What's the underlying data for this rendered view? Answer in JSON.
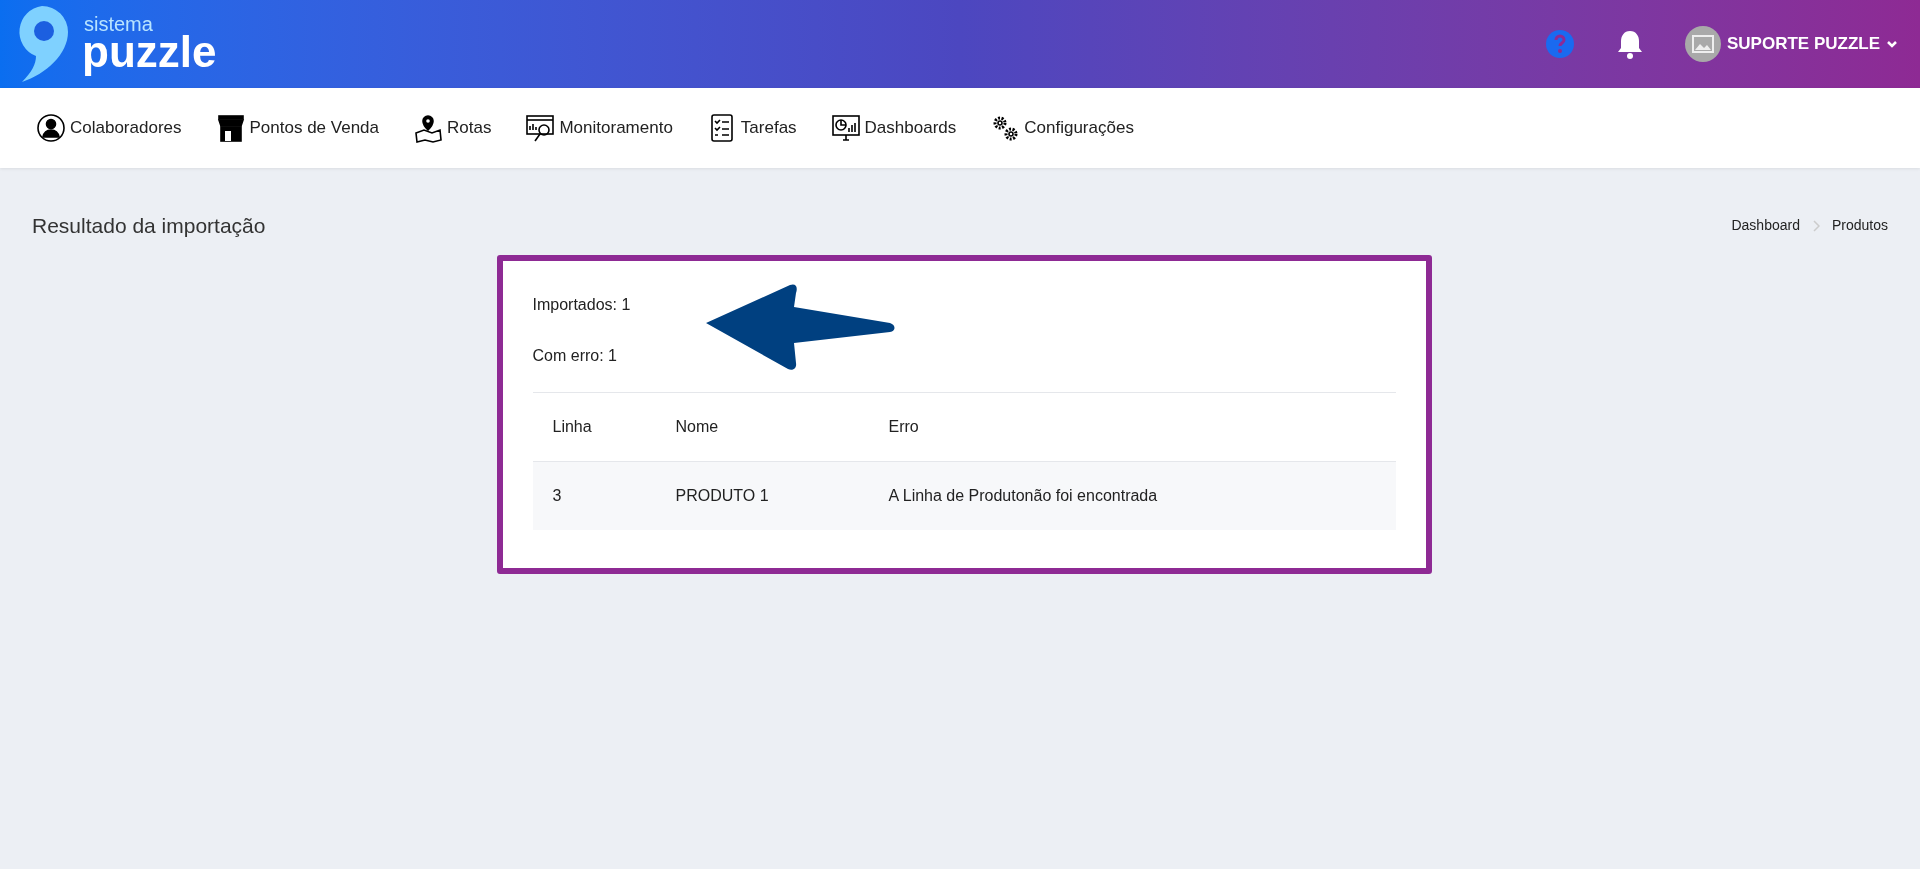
{
  "logo": {
    "small": "sistema",
    "big": "puzzle"
  },
  "user": {
    "name": "SUPORTE PUZZLE"
  },
  "nav": [
    {
      "label": "Colaboradores",
      "kind": "person"
    },
    {
      "label": "Pontos de Venda",
      "kind": "store"
    },
    {
      "label": "Rotas",
      "kind": "map"
    },
    {
      "label": "Monitoramento",
      "kind": "monitor"
    },
    {
      "label": "Tarefas",
      "kind": "tasks"
    },
    {
      "label": "Dashboards",
      "kind": "dashboard"
    },
    {
      "label": "Configurações",
      "kind": "gears"
    }
  ],
  "page_title": "Resultado da importação",
  "breadcrumb": [
    "Dashboard",
    "Produtos"
  ],
  "summary": [
    "Importados: 1",
    "Com erro: 1"
  ],
  "table": {
    "columns": [
      "Linha",
      "Nome",
      "Erro"
    ],
    "rows": [
      [
        "3",
        "PRODUTO 1",
        "A Linha de Produtonão foi encontrada"
      ]
    ]
  }
}
